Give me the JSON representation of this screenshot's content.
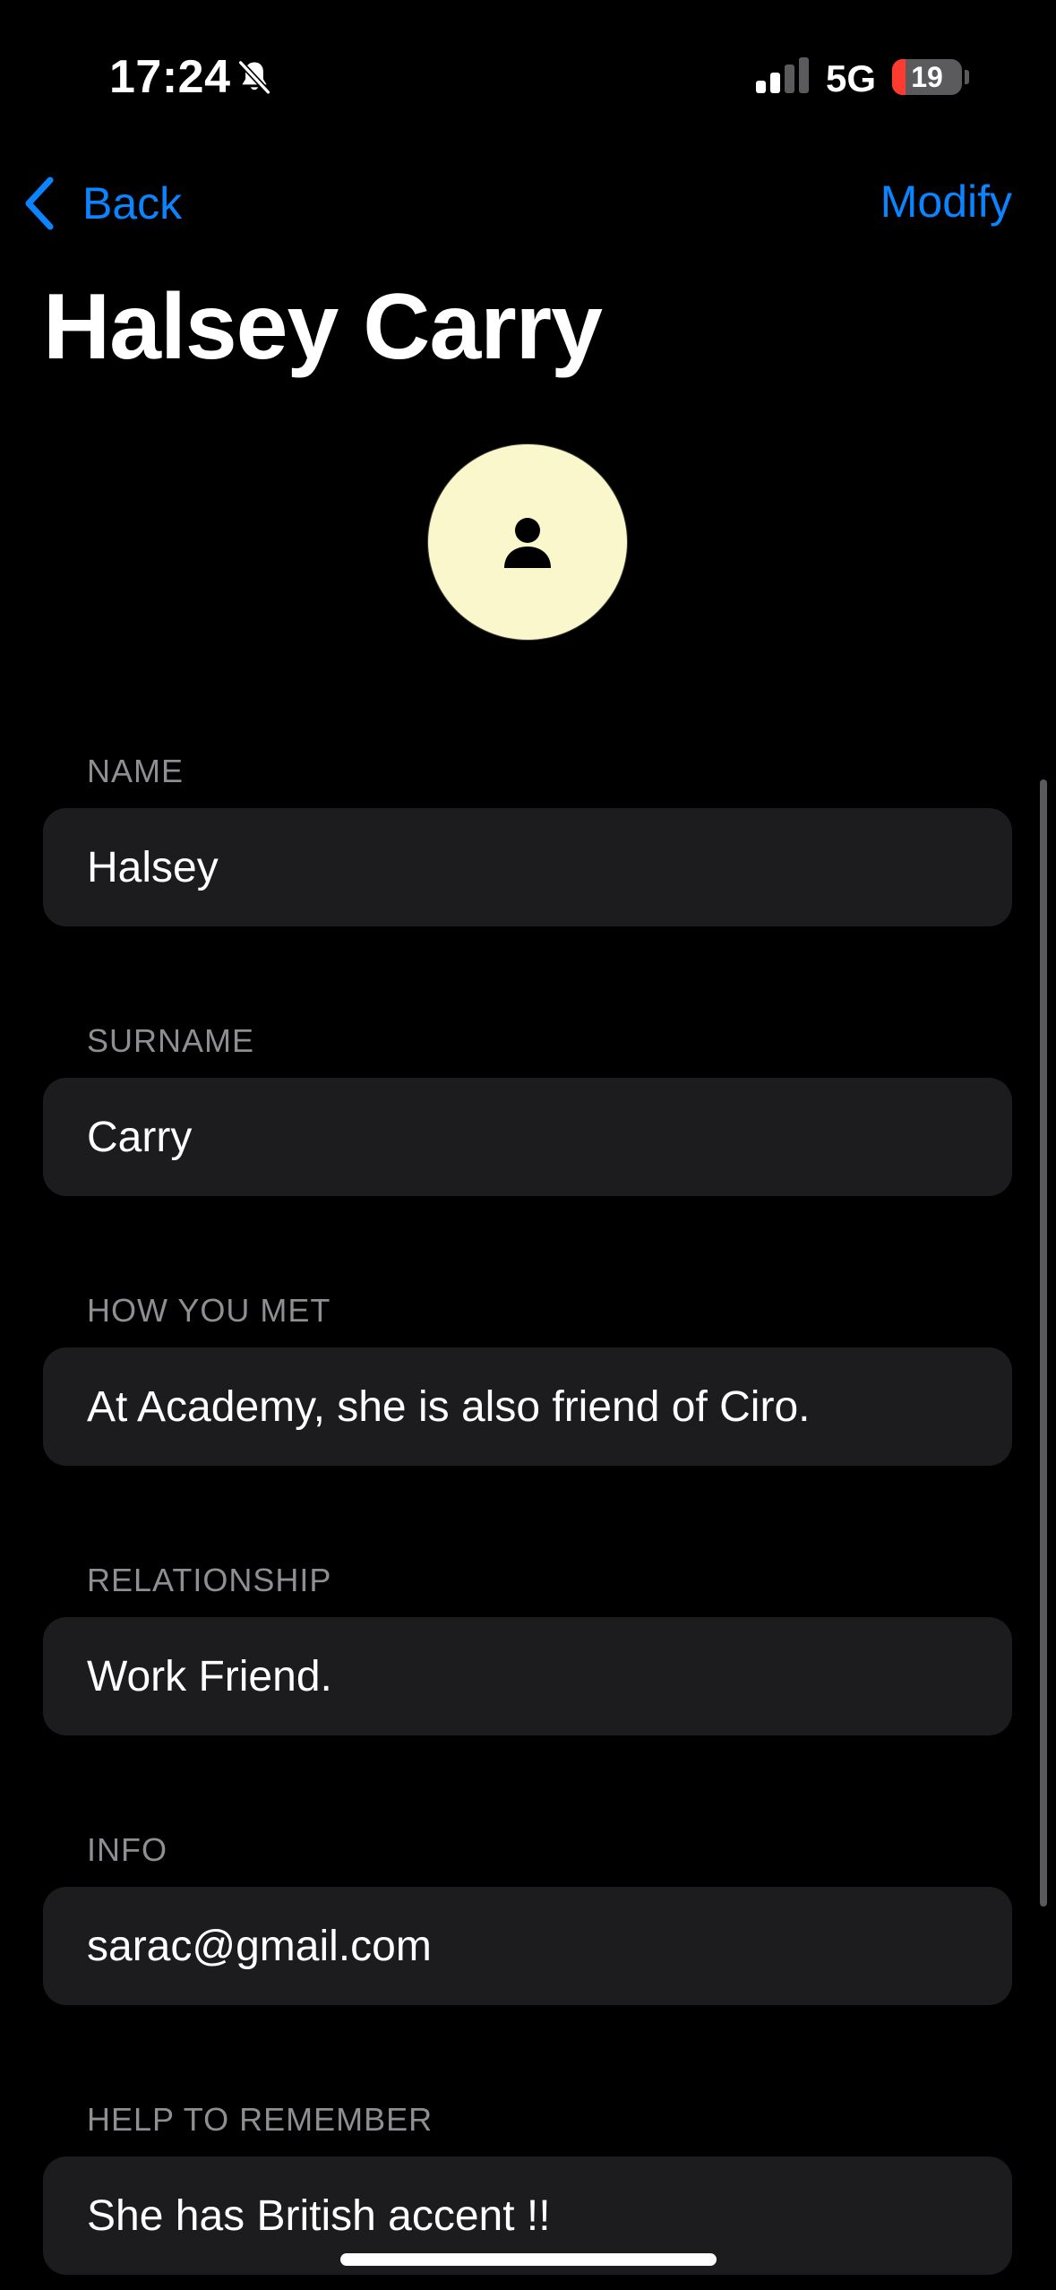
{
  "status_bar": {
    "time": "17:24",
    "network": "5G",
    "battery_level": "19",
    "battery_fraction": 0.19,
    "silent_mode_icon": "bell-slash-icon"
  },
  "nav": {
    "back_label": "Back",
    "modify_label": "Modify"
  },
  "contact": {
    "title": "Halsey Carry",
    "avatar_icon": "person-icon",
    "avatar_color": "#fbf7cc"
  },
  "fields": [
    {
      "label": "NAME",
      "value": "Halsey"
    },
    {
      "label": "SURNAME",
      "value": "Carry"
    },
    {
      "label": "HOW YOU MET",
      "value": "At Academy, she is also friend of Ciro."
    },
    {
      "label": "RELATIONSHIP",
      "value": "Work Friend."
    },
    {
      "label": "INFO",
      "value": "sarac@gmail.com"
    },
    {
      "label": "HELP TO REMEMBER",
      "value": "She has British accent !!"
    }
  ],
  "colors": {
    "accent": "#0a84ff",
    "background": "#000000",
    "field_background": "#1c1c1e",
    "label": "#8e8e93",
    "battery_low": "#ff3b30"
  }
}
